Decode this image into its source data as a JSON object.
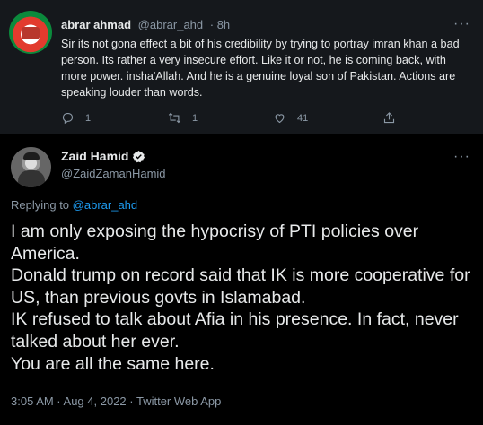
{
  "reply": {
    "name": "abrar ahmad",
    "handle": "@abrar_ahd",
    "time": "· 8h",
    "text": "Sir its not gona effect a bit of his credibility by trying to portray imran khan a bad person. Its rather a very insecure effort. Like it or not, he is coming back, with more power. insha'Allah. And he is a genuine loyal son of Pakistan. Actions are speaking louder than words.",
    "reply_count": "1",
    "retweet_count": "1",
    "like_count": "41"
  },
  "tweet": {
    "name": "Zaid Hamid",
    "handle": "@ZaidZamanHamid",
    "replying_prefix": "Replying to",
    "replying_to": "@abrar_ahd",
    "text_lines": [
      "I am only exposing the hypocrisy of PTI policies over America.",
      "Donald trump on record said that IK is more cooperative for US, than previous govts in Islamabad.",
      "IK refused to talk about Afia in his presence. In fact, never talked about her ever.",
      "You are all the same here."
    ],
    "meta": "3:05 AM · Aug 4, 2022 · Twitter Web App"
  },
  "colors": {
    "accent": "#1d9bf0",
    "secondary_text": "#8b98a5",
    "reply_bg": "#15181c"
  },
  "icons": [
    "more-icon",
    "reply-icon",
    "retweet-icon",
    "like-icon",
    "share-icon",
    "verified-icon"
  ]
}
